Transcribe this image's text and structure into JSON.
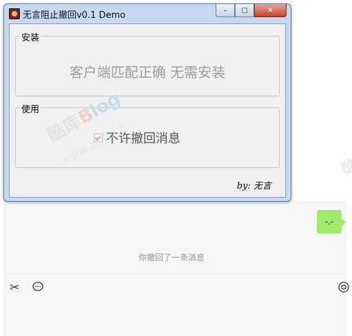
{
  "window": {
    "title": "无言阻止撤回v0.1 Demo",
    "controls": {
      "minimize": "–",
      "maximize": "□",
      "close": "✕"
    }
  },
  "install_group": {
    "legend": "安装",
    "message": "客户端匹配正确 无需安装"
  },
  "use_group": {
    "legend": "使用",
    "option_label": "不许撤回消息",
    "option_checked": true
  },
  "author": "by: 无言",
  "watermark": {
    "part1": "酷库",
    "part2": "B",
    "part3": "log",
    "url": "www.zxki.cn"
  },
  "chat": {
    "bubble_text": "-.-",
    "recall_notice": "你撤回了一条消息",
    "tools": [
      "scissors-icon",
      "chat-bubble-icon"
    ]
  }
}
